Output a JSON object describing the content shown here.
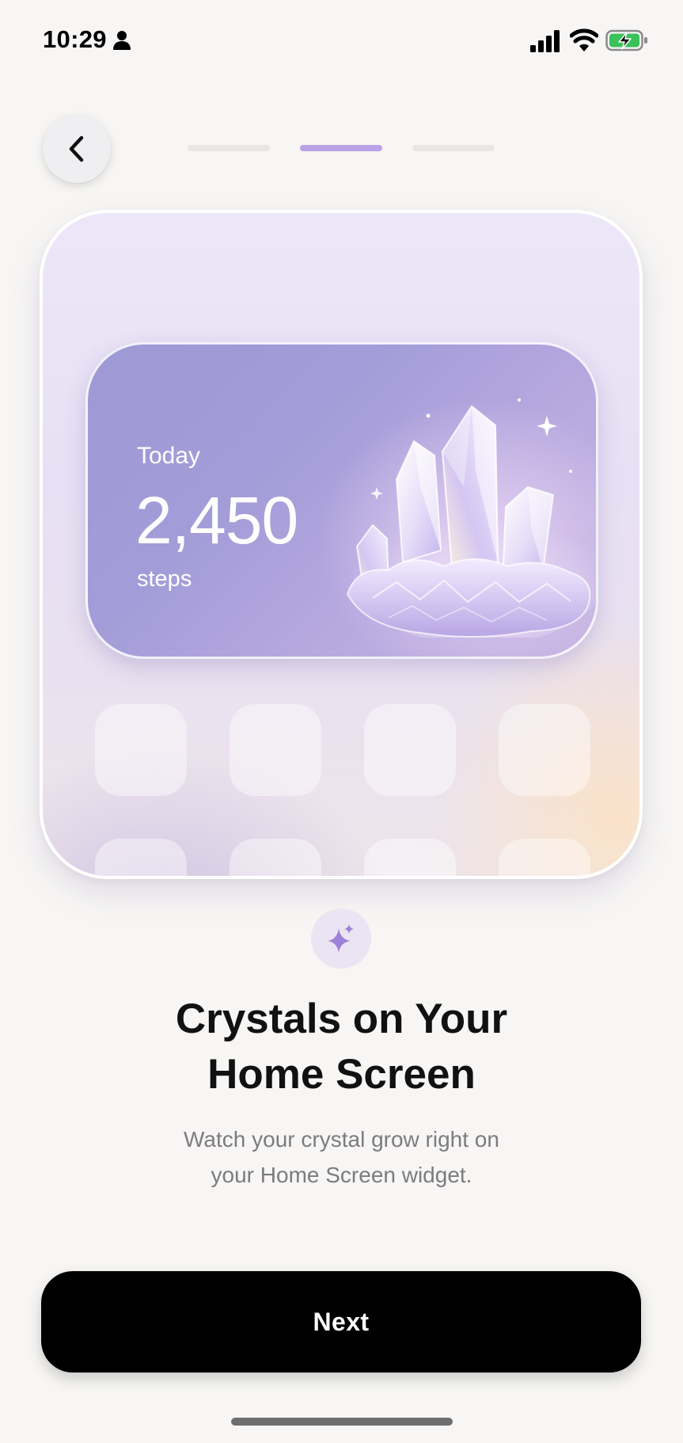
{
  "status_bar": {
    "time": "10:29",
    "icons": [
      "person-icon",
      "cellular-signal-icon",
      "wifi-icon",
      "battery-charging-icon"
    ]
  },
  "nav": {
    "back_icon": "chevron-left-icon",
    "progress": {
      "total_steps": 3,
      "current_step": 2
    }
  },
  "widget": {
    "label": "Today",
    "value": "2,450",
    "unit": "steps",
    "image": "crystal-cluster"
  },
  "sparkle_icon": "sparkle-icon",
  "headline": {
    "line1": "Crystals on Your",
    "line2": "Home Screen"
  },
  "description": {
    "line1": "Watch your crystal grow right on",
    "line2": "your Home Screen widget."
  },
  "next_button": {
    "label": "Next"
  },
  "colors": {
    "background": "#f7f6f4",
    "progress_active": "#b9a3e6",
    "progress_inactive": "#e9e7e3",
    "accent": "#9d83d9",
    "button": "#000000"
  }
}
